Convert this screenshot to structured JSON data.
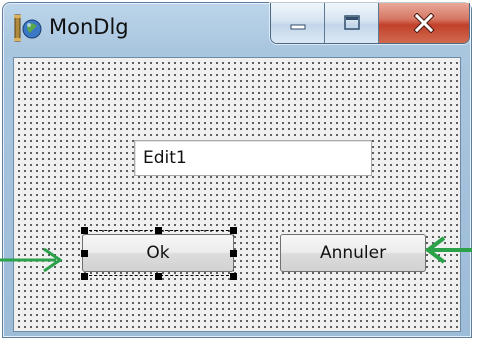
{
  "window": {
    "title": "MonDlg",
    "icon": "app-icon",
    "caption_buttons": [
      "minimize-icon",
      "maximize-icon",
      "close-icon"
    ]
  },
  "dialog": {
    "edit_field": {
      "value": "Edit1"
    },
    "ok_button": {
      "label": "Ok",
      "selected": true
    },
    "cancel_button": {
      "label": "Annuler"
    }
  },
  "annotations": {
    "arrow_color": "#2ba14a"
  },
  "colors": {
    "titlebar": "#a9c6df",
    "close_button": "#c2412a",
    "client_background": "#f0f0f0"
  }
}
